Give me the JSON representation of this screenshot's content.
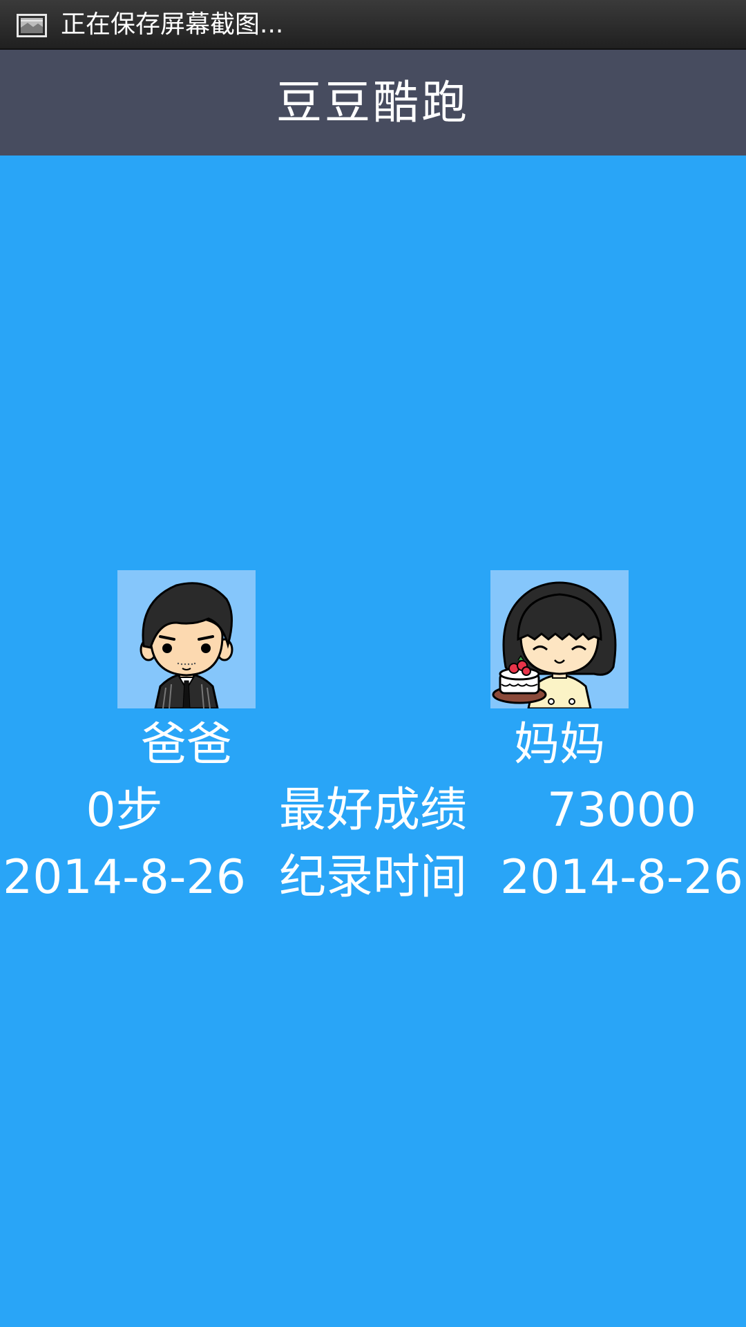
{
  "status_bar": {
    "icon": "screenshot-icon",
    "text": "正在保存屏幕截图..."
  },
  "app": {
    "title": "豆豆酷跑"
  },
  "players": [
    {
      "name": "爸爸",
      "avatar": "dad-avatar",
      "score": "0步",
      "date": "2014-8-26"
    },
    {
      "name": "妈妈",
      "avatar": "mom-avatar",
      "score": "73000",
      "date": "2014-8-26"
    }
  ],
  "labels": {
    "best_score": "最好成绩",
    "record_time": "纪录时间"
  },
  "colors": {
    "background": "#29a5f7",
    "title_bar": "#474c5f",
    "avatar_bg": "#85c6fb",
    "text": "#ffffff"
  }
}
